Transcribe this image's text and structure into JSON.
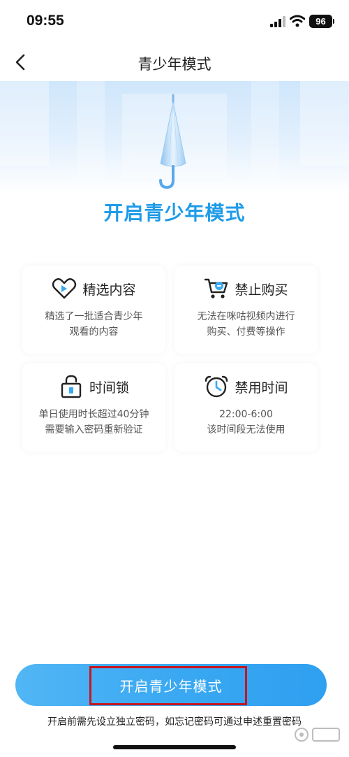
{
  "status_bar": {
    "time": "09:55",
    "battery": "96"
  },
  "nav": {
    "title": "青少年模式"
  },
  "hero": {
    "title": "开启青少年模式"
  },
  "features": [
    {
      "title": "精选内容",
      "icon": "heart-play-icon",
      "desc_line1": "精选了一批适合青少年",
      "desc_line2": "观看的内容"
    },
    {
      "title": "禁止购买",
      "icon": "shopping-cart-icon",
      "desc_line1": "无法在咪咕视频内进行",
      "desc_line2": "购买、付费等操作"
    },
    {
      "title": "时间锁",
      "icon": "lock-icon",
      "desc_line1": "单日使用时长超过40分钟",
      "desc_line2": "需要输入密码重新验证"
    },
    {
      "title": "禁用时间",
      "icon": "alarm-clock-icon",
      "desc_line1": "22:00-6:00",
      "desc_line2": "该时间段无法使用"
    }
  ],
  "cta": {
    "label": "开启青少年模式"
  },
  "footer": {
    "note": "开启前需先设立独立密码，如忘记密码可通过申述重置密码"
  },
  "colors": {
    "accent": "#1e9be8",
    "button": "#3aa9f2",
    "highlight": "#c8141e"
  }
}
